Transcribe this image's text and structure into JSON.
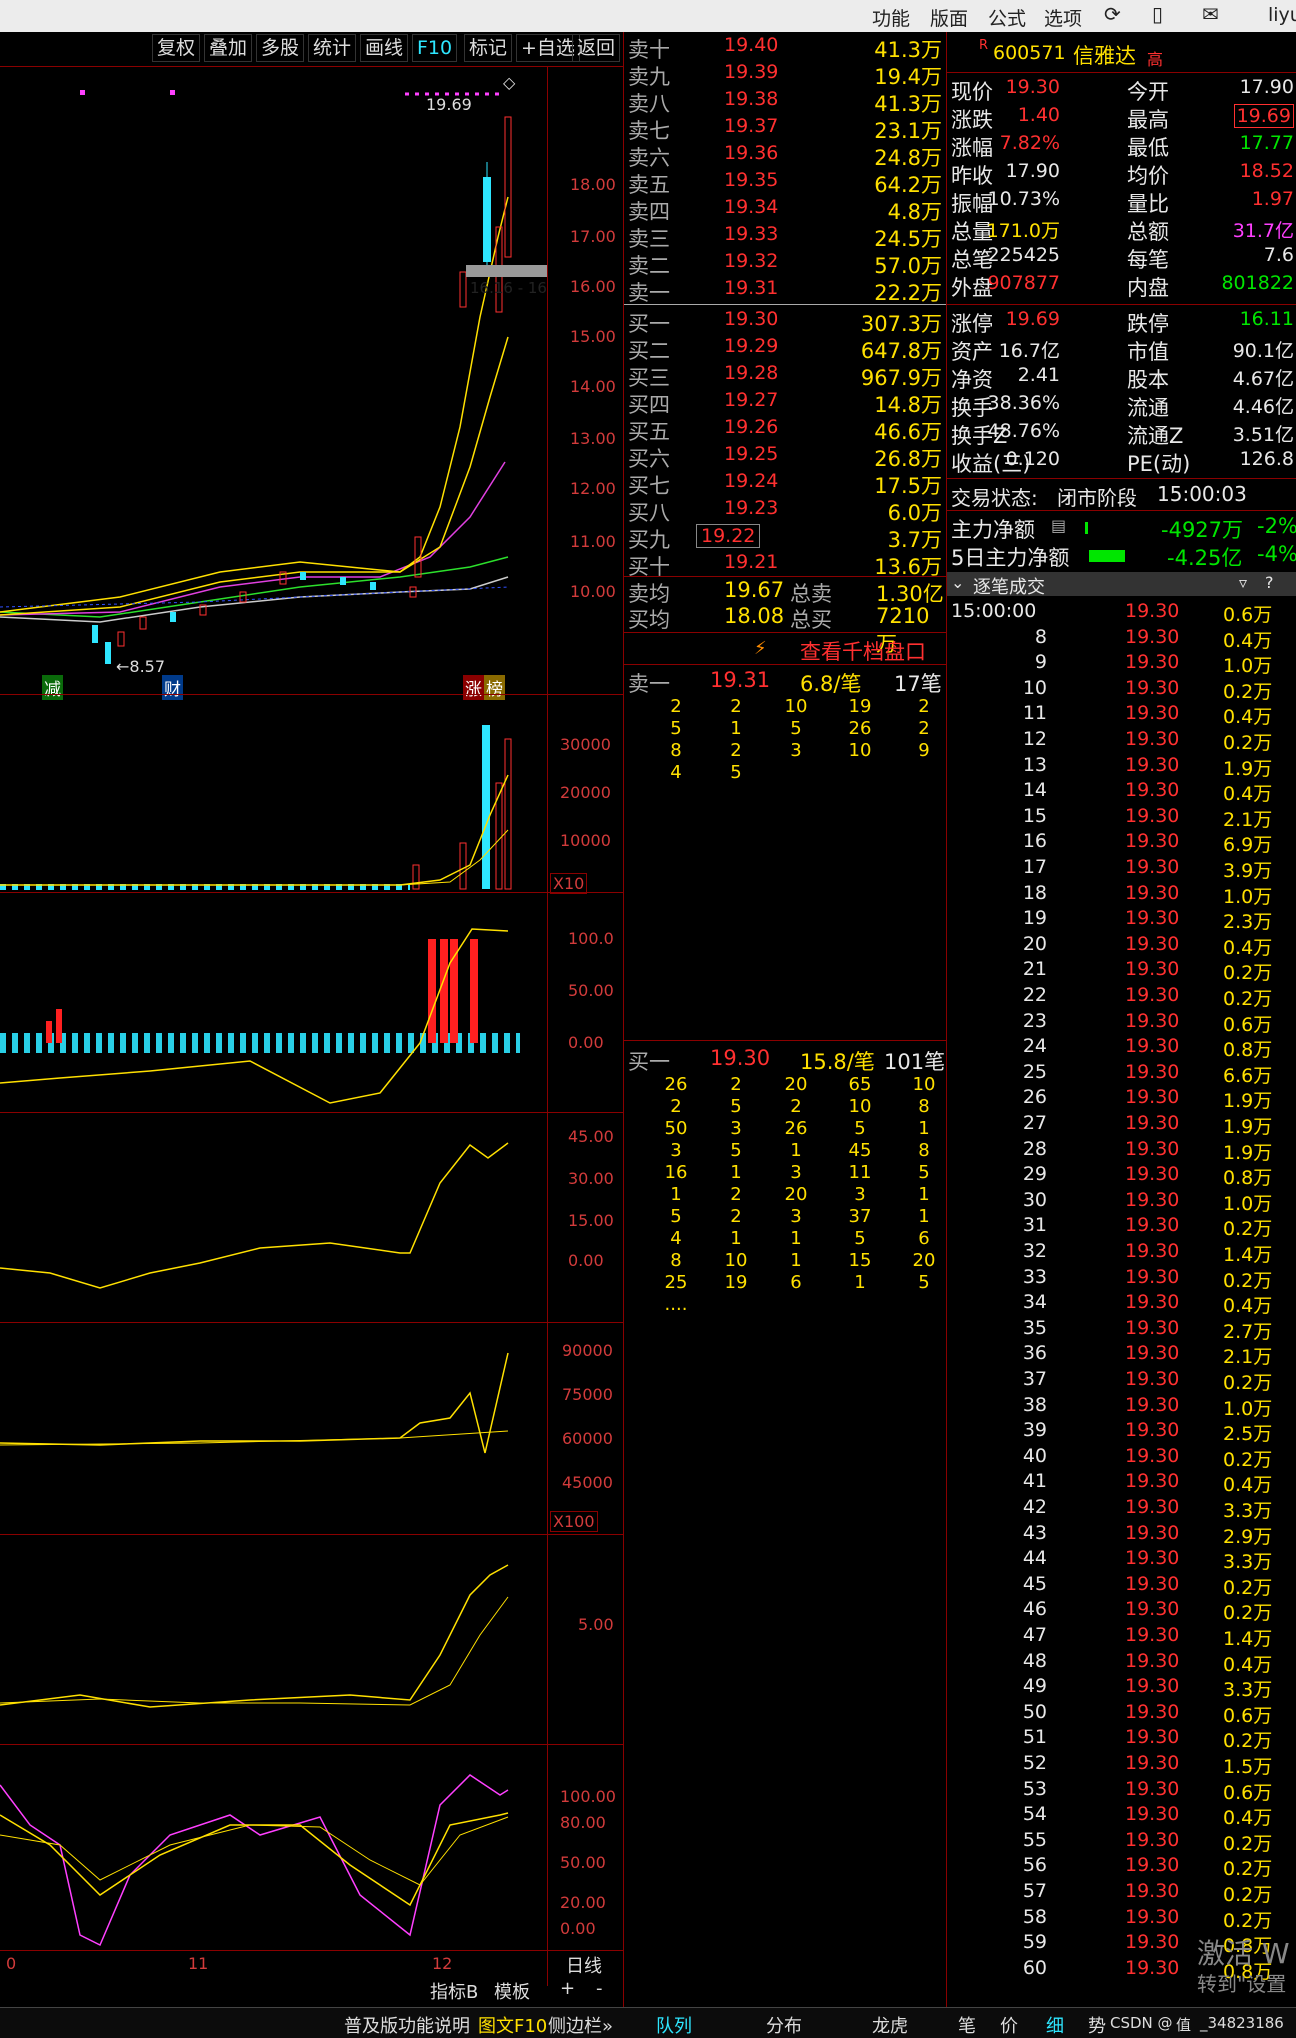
{
  "topmenu": [
    "功能",
    "版面",
    "公式",
    "选项",
    "liyu"
  ],
  "toolbar": [
    "复权",
    "叠加",
    "多股",
    "统计",
    "画线",
    "F10",
    "标记",
    "+自选",
    "返回"
  ],
  "stock": {
    "badge": "R",
    "code": "600571",
    "name": "信雅达",
    "tag": "高"
  },
  "price_axis": [
    "18.00",
    "17.00",
    "16.00",
    "15.00",
    "14.00",
    "13.00",
    "12.00",
    "11.00",
    "10.00"
  ],
  "chart_labels": {
    "high": "19.69",
    "low": "←8.57",
    "box": "16.16 - 16",
    "events": [
      "减",
      "财",
      "涨",
      "榜"
    ]
  },
  "vol_axis": [
    "30000",
    "20000",
    "10000",
    "X10"
  ],
  "macd_axis": [
    "100.0",
    "50.00",
    "0.00"
  ],
  "ind3_axis": [
    "45.00",
    "30.00",
    "15.00",
    "0.00"
  ],
  "ind4_axis": [
    "90000",
    "75000",
    "60000",
    "45000",
    "X100"
  ],
  "ind5_axis": [
    "5.00"
  ],
  "ind6_axis": [
    "100.00",
    "80.00",
    "50.00",
    "20.00",
    "0.00"
  ],
  "date_axis": [
    "0",
    "11",
    "12"
  ],
  "bottom": {
    "period": "日线",
    "ind": "指标B",
    "tpl": "模板",
    "plus": "+",
    "minus": "-",
    "status": [
      "普及版功能说明",
      "图文F10",
      "侧边栏»"
    ],
    "tabs": [
      "队列",
      "分布",
      "龙虎",
      "笔",
      "价",
      "细",
      "势",
      "CSDN @",
      "值",
      "_34823186"
    ]
  },
  "sell": [
    [
      "卖十",
      "19.40",
      "41.3万"
    ],
    [
      "卖九",
      "19.39",
      "19.4万"
    ],
    [
      "卖八",
      "19.38",
      "41.3万"
    ],
    [
      "卖七",
      "19.37",
      "23.1万"
    ],
    [
      "卖六",
      "19.36",
      "24.8万"
    ],
    [
      "卖五",
      "19.35",
      "64.2万"
    ],
    [
      "卖四",
      "19.34",
      "4.8万"
    ],
    [
      "卖三",
      "19.33",
      "24.5万"
    ],
    [
      "卖二",
      "19.32",
      "57.0万"
    ],
    [
      "卖一",
      "19.31",
      "22.2万"
    ]
  ],
  "buy": [
    [
      "买一",
      "19.30",
      "307.3万"
    ],
    [
      "买二",
      "19.29",
      "647.8万"
    ],
    [
      "买三",
      "19.28",
      "967.9万"
    ],
    [
      "买四",
      "19.27",
      "14.8万"
    ],
    [
      "买五",
      "19.26",
      "46.6万"
    ],
    [
      "买六",
      "19.25",
      "26.8万"
    ],
    [
      "买七",
      "19.24",
      "17.5万"
    ],
    [
      "买八",
      "19.23",
      "6.0万"
    ],
    [
      "买九",
      "19.22",
      "3.7万"
    ],
    [
      "买十",
      "19.21",
      "13.6万"
    ]
  ],
  "avg": [
    [
      "卖均",
      "19.67",
      "总卖",
      "1.30亿"
    ],
    [
      "买均",
      "18.08",
      "总买",
      "7210万"
    ]
  ],
  "qiandang": "查看千档盘口",
  "sell_queue": {
    "label": "卖一",
    "price": "19.31",
    "per": "6.8/笔",
    "count": "17笔",
    "rows": [
      [
        "2",
        "2",
        "10",
        "19",
        "2"
      ],
      [
        "5",
        "1",
        "5",
        "26",
        "2"
      ],
      [
        "8",
        "2",
        "3",
        "10",
        "9"
      ],
      [
        "4",
        "5",
        "",
        "",
        ""
      ]
    ]
  },
  "buy_queue": {
    "label": "买一",
    "price": "19.30",
    "per": "15.8/笔",
    "count": "101笔",
    "rows": [
      [
        "26",
        "2",
        "20",
        "65",
        "10"
      ],
      [
        "2",
        "5",
        "2",
        "10",
        "8"
      ],
      [
        "50",
        "3",
        "26",
        "5",
        "1"
      ],
      [
        "3",
        "5",
        "1",
        "45",
        "8"
      ],
      [
        "16",
        "1",
        "3",
        "11",
        "5"
      ],
      [
        "1",
        "2",
        "20",
        "3",
        "1"
      ],
      [
        "5",
        "2",
        "3",
        "37",
        "1"
      ],
      [
        "4",
        "1",
        "1",
        "5",
        "6"
      ],
      [
        "8",
        "10",
        "1",
        "15",
        "20"
      ],
      [
        "25",
        "19",
        "6",
        "1",
        "5"
      ],
      [
        "....",
        "",
        "",
        "",
        ""
      ]
    ]
  },
  "quote": [
    [
      "现价",
      "19.30",
      "今开",
      "17.90"
    ],
    [
      "涨跌",
      "1.40",
      "最高",
      "19.69"
    ],
    [
      "涨幅",
      "7.82%",
      "最低",
      "17.77"
    ],
    [
      "昨收",
      "17.90",
      "均价",
      "18.52"
    ],
    [
      "振幅",
      "10.73%",
      "量比",
      "1.97"
    ],
    [
      "总量",
      "171.0万",
      "总额",
      "31.7亿"
    ],
    [
      "总笔",
      "225425",
      "每笔",
      "7.6"
    ],
    [
      "外盘",
      "907877",
      "内盘",
      "801822"
    ]
  ],
  "quote2": [
    [
      "涨停",
      "19.69",
      "跌停",
      "16.11"
    ],
    [
      "资产",
      "16.7亿",
      "市值",
      "90.1亿"
    ],
    [
      "净资",
      "2.41",
      "股本",
      "4.67亿"
    ],
    [
      "换手",
      "38.36%",
      "流通",
      "4.46亿"
    ],
    [
      "换手Z",
      "48.76%",
      "流通Z",
      "3.51亿"
    ],
    [
      "收益(三)",
      "0.120",
      "PE(动)",
      "126.8"
    ]
  ],
  "trade_state": [
    "交易状态:",
    "闭市阶段",
    "15:00:03"
  ],
  "netflow": [
    [
      "主力净额",
      "-4927万",
      "-2%"
    ],
    [
      "5日主力净额",
      "-4.25亿",
      "-4%"
    ]
  ],
  "ticks_title": "逐笔成交",
  "ticks": [
    [
      "15:00:00",
      "19.30",
      "0.6万"
    ],
    [
      "8",
      "19.30",
      "0.4万"
    ],
    [
      "9",
      "19.30",
      "1.0万"
    ],
    [
      "10",
      "19.30",
      "0.2万"
    ],
    [
      "11",
      "19.30",
      "0.4万"
    ],
    [
      "12",
      "19.30",
      "0.2万"
    ],
    [
      "13",
      "19.30",
      "1.9万"
    ],
    [
      "14",
      "19.30",
      "0.4万"
    ],
    [
      "15",
      "19.30",
      "2.1万"
    ],
    [
      "16",
      "19.30",
      "6.9万"
    ],
    [
      "17",
      "19.30",
      "3.9万"
    ],
    [
      "18",
      "19.30",
      "1.0万"
    ],
    [
      "19",
      "19.30",
      "2.3万"
    ],
    [
      "20",
      "19.30",
      "0.4万"
    ],
    [
      "21",
      "19.30",
      "0.2万"
    ],
    [
      "22",
      "19.30",
      "0.2万"
    ],
    [
      "23",
      "19.30",
      "0.6万"
    ],
    [
      "24",
      "19.30",
      "0.8万"
    ],
    [
      "25",
      "19.30",
      "6.6万"
    ],
    [
      "26",
      "19.30",
      "1.9万"
    ],
    [
      "27",
      "19.30",
      "1.9万"
    ],
    [
      "28",
      "19.30",
      "1.9万"
    ],
    [
      "29",
      "19.30",
      "0.8万"
    ],
    [
      "30",
      "19.30",
      "1.0万"
    ],
    [
      "31",
      "19.30",
      "0.2万"
    ],
    [
      "32",
      "19.30",
      "1.4万"
    ],
    [
      "33",
      "19.30",
      "0.2万"
    ],
    [
      "34",
      "19.30",
      "0.4万"
    ],
    [
      "35",
      "19.30",
      "2.7万"
    ],
    [
      "36",
      "19.30",
      "2.1万"
    ],
    [
      "37",
      "19.30",
      "0.2万"
    ],
    [
      "38",
      "19.30",
      "1.0万"
    ],
    [
      "39",
      "19.30",
      "2.5万"
    ],
    [
      "40",
      "19.30",
      "0.2万"
    ],
    [
      "41",
      "19.30",
      "0.4万"
    ],
    [
      "42",
      "19.30",
      "3.3万"
    ],
    [
      "43",
      "19.30",
      "2.9万"
    ],
    [
      "44",
      "19.30",
      "3.3万"
    ],
    [
      "45",
      "19.30",
      "0.2万"
    ],
    [
      "46",
      "19.30",
      "0.2万"
    ],
    [
      "47",
      "19.30",
      "1.4万"
    ],
    [
      "48",
      "19.30",
      "0.4万"
    ],
    [
      "49",
      "19.30",
      "3.3万"
    ],
    [
      "50",
      "19.30",
      "0.6万"
    ],
    [
      "51",
      "19.30",
      "0.2万"
    ],
    [
      "52",
      "19.30",
      "1.5万"
    ],
    [
      "53",
      "19.30",
      "0.6万"
    ],
    [
      "54",
      "19.30",
      "0.4万"
    ],
    [
      "55",
      "19.30",
      "0.2万"
    ],
    [
      "56",
      "19.30",
      "0.2万"
    ],
    [
      "57",
      "19.30",
      "0.2万"
    ],
    [
      "58",
      "19.30",
      "0.2万"
    ],
    [
      "59",
      "19.30",
      "0.8万"
    ],
    [
      "60",
      "19.30",
      "0.8万"
    ]
  ],
  "watermark": [
    "激活 W",
    "转到\"设置"
  ]
}
